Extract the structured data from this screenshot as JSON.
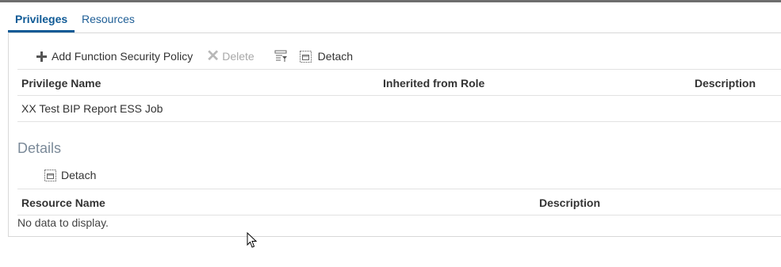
{
  "tabs": [
    {
      "label": "Privileges",
      "active": true
    },
    {
      "label": "Resources",
      "active": false
    }
  ],
  "privileges_toolbar": {
    "add_label": "Add Function Security Policy",
    "delete_label": "Delete",
    "detach_label": "Detach"
  },
  "privileges_table": {
    "columns": [
      "Privilege Name",
      "Inherited from Role",
      "Description"
    ],
    "rows": [
      [
        "XX Test BIP Report ESS Job",
        "",
        ""
      ]
    ]
  },
  "details": {
    "title": "Details",
    "detach_label": "Detach",
    "columns": [
      "Resource Name",
      "Description"
    ],
    "empty_text": "No data to display."
  },
  "icons": {
    "add": "plus-icon",
    "delete": "x-icon",
    "query_by_example": "filter-icon",
    "detach": "detach-frame-icon"
  },
  "colors": {
    "accent": "#0f5a96",
    "disabled": "#a8a8a8",
    "section_title": "#7b8a99"
  }
}
